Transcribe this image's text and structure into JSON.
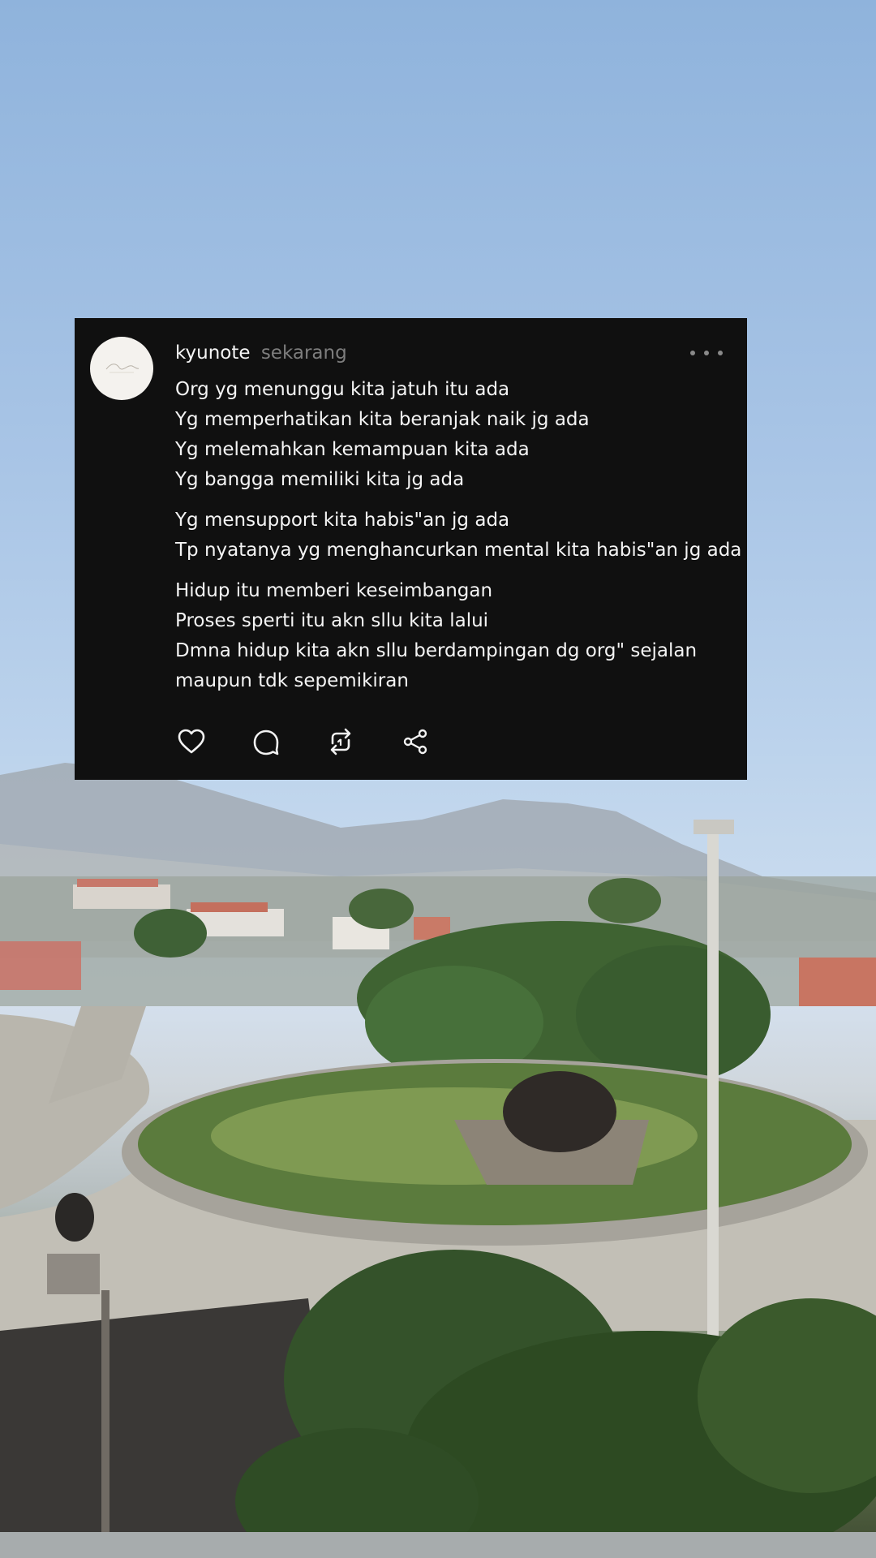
{
  "post": {
    "username": "kyunote",
    "timestamp": "sekarang",
    "paragraphs": [
      {
        "lines": [
          "Org yg menunggu kita jatuh itu ada",
          "Yg memperhatikan kita beranjak naik jg ada",
          "Yg melemahkan kemampuan kita ada",
          "Yg bangga memiliki kita jg ada"
        ]
      },
      {
        "lines": [
          "Yg mensupport kita habis\"an jg ada",
          "Tp nyatanya yg menghancurkan mental kita habis\"an jg ada"
        ]
      },
      {
        "lines": [
          "Hidup itu memberi keseimbangan",
          "Proses sperti itu akn sllu kita lalui",
          "Dmna hidup kita akn sllu berdampingan dg org\" sejalan",
          "maupun tdk sepemikiran"
        ]
      }
    ],
    "actions": [
      {
        "name": "like-icon",
        "label": "like"
      },
      {
        "name": "comment-icon",
        "label": "comment"
      },
      {
        "name": "repost-icon",
        "label": "repost"
      },
      {
        "name": "share-icon",
        "label": "share"
      }
    ]
  },
  "colors": {
    "card_background": "#101010",
    "text_primary": "#f4f4f4",
    "text_secondary": "#7d7d7d"
  }
}
